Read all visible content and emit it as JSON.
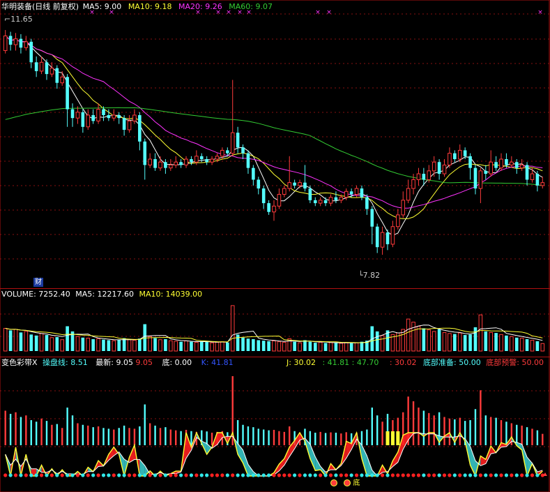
{
  "colors": {
    "bg": "#000000",
    "up": "#ff3b3b",
    "down": "#54ffff",
    "ma5": "#ffffff",
    "ma10": "#ffff33",
    "ma20": "#ff33ff",
    "ma60": "#33cc33",
    "grid": "#8a1010",
    "vol_ma5": "#ffffff",
    "vol_ma10": "#ffff33",
    "ribbon_up": "#ff2020",
    "ribbon_down": "#38c8c8",
    "dot_red": "#ff2020",
    "dot_cyan": "#30e8e8",
    "yellow": "#ffff33"
  },
  "main_header": {
    "name": "华明装备(日线 前复权)",
    "ma5_label": "MA5: 9.00",
    "ma10_label": "MA10: 9.18",
    "ma20_label": "MA20: 9.26",
    "ma60_label": "MA60: 9.07"
  },
  "annotations": {
    "high_label": "11.65",
    "low_label": "7.82",
    "cai_badge": "财",
    "di_label": "底",
    "cross_marker": "×"
  },
  "volume_header": {
    "title": "VOLUME: 7252.40",
    "ma5": "MA5: 12217.60",
    "ma10": "MA10: 14039.00"
  },
  "indicator_header": {
    "name": "变色彩带X",
    "caopan": "操盘线: 8.51",
    "zuixin": "最新: 9.05",
    "zuixin2": "9.05",
    "di": "底: 0.00",
    "k": "K: 41.81",
    "j": "J: 30.02",
    "v1": ": 41.81",
    "v2": ": 47.70",
    "v3": ": 30.02",
    "dibu_zhunbei": "底部准备: 50.00",
    "dibu_yujing": "底部预警: 50.00"
  },
  "chart_data": [
    {
      "type": "candlestick",
      "title": "华明装备(日线 前复权)",
      "ylim": [
        7.5,
        11.9
      ],
      "annotations": {
        "high": 11.65,
        "low": 7.82
      },
      "ma_latest": {
        "MA5": 9.0,
        "MA10": 9.18,
        "MA20": 9.26,
        "MA60": 9.07
      },
      "candles": [
        [
          11.3,
          11.55,
          11.65,
          11.25
        ],
        [
          11.55,
          11.4,
          11.62,
          11.3
        ],
        [
          11.4,
          11.5,
          11.6,
          11.3
        ],
        [
          11.5,
          11.35,
          11.58,
          11.25
        ],
        [
          11.35,
          11.45,
          11.55,
          11.3
        ],
        [
          11.45,
          11.1,
          11.5,
          11.0
        ],
        [
          11.1,
          10.95,
          11.2,
          10.85
        ],
        [
          10.95,
          11.1,
          11.2,
          10.9
        ],
        [
          11.1,
          10.9,
          11.15,
          10.8
        ],
        [
          10.9,
          11.0,
          11.1,
          10.85
        ],
        [
          11.0,
          10.75,
          11.05,
          10.65
        ],
        [
          10.75,
          10.85,
          10.95,
          10.7
        ],
        [
          10.85,
          10.3,
          10.9,
          10.0
        ],
        [
          10.3,
          10.15,
          10.4,
          10.0
        ],
        [
          10.15,
          10.25,
          10.35,
          10.05
        ],
        [
          10.25,
          10.0,
          10.3,
          9.9
        ],
        [
          10.0,
          10.2,
          10.3,
          9.95
        ],
        [
          10.2,
          10.1,
          10.3,
          10.05
        ],
        [
          10.1,
          10.3,
          10.4,
          10.05
        ],
        [
          10.3,
          10.2,
          10.35,
          10.1
        ],
        [
          10.2,
          10.15,
          10.3,
          10.1
        ],
        [
          10.15,
          10.2,
          10.3,
          10.1
        ],
        [
          10.2,
          10.15,
          10.25,
          10.05
        ],
        [
          10.15,
          9.95,
          10.2,
          9.85
        ],
        [
          9.95,
          10.1,
          10.2,
          9.9
        ],
        [
          10.1,
          10.2,
          10.3,
          10.05
        ],
        [
          10.2,
          9.75,
          10.25,
          9.6
        ],
        [
          9.75,
          9.35,
          9.8,
          9.1
        ],
        [
          9.35,
          9.45,
          9.55,
          9.3
        ],
        [
          9.45,
          9.3,
          9.55,
          9.25
        ],
        [
          9.3,
          9.4,
          9.5,
          9.25
        ],
        [
          9.4,
          9.3,
          9.45,
          9.2
        ],
        [
          9.3,
          9.35,
          9.45,
          9.25
        ],
        [
          9.35,
          9.4,
          9.5,
          9.3
        ],
        [
          9.4,
          9.35,
          9.45,
          9.3
        ],
        [
          9.35,
          9.45,
          9.5,
          9.3
        ],
        [
          9.45,
          9.4,
          9.5,
          9.35
        ],
        [
          9.4,
          9.5,
          9.6,
          9.35
        ],
        [
          9.5,
          9.45,
          9.55,
          9.4
        ],
        [
          9.45,
          9.4,
          9.5,
          9.35
        ],
        [
          9.4,
          9.45,
          9.5,
          9.35
        ],
        [
          9.45,
          9.5,
          9.55,
          9.4
        ],
        [
          9.5,
          9.6,
          9.65,
          9.45
        ],
        [
          9.6,
          9.55,
          9.65,
          9.5
        ],
        [
          9.55,
          9.9,
          10.8,
          9.5
        ],
        [
          9.9,
          9.65,
          10.0,
          9.55
        ],
        [
          9.65,
          9.55,
          9.7,
          9.45
        ],
        [
          9.55,
          9.3,
          9.6,
          9.2
        ],
        [
          9.3,
          9.1,
          9.35,
          9.0
        ],
        [
          9.1,
          8.95,
          9.15,
          8.85
        ],
        [
          8.95,
          8.7,
          9.0,
          8.6
        ],
        [
          8.7,
          8.55,
          8.75,
          8.5
        ],
        [
          8.55,
          8.65,
          8.75,
          8.4
        ],
        [
          8.65,
          8.85,
          8.95,
          8.6
        ],
        [
          8.85,
          8.95,
          9.0,
          8.8
        ],
        [
          8.95,
          9.05,
          9.5,
          8.9
        ],
        [
          9.05,
          9.0,
          9.1,
          8.95
        ],
        [
          9.0,
          9.05,
          9.1,
          8.95
        ],
        [
          9.05,
          8.95,
          9.35,
          8.9
        ],
        [
          8.95,
          8.75,
          9.0,
          8.7
        ],
        [
          8.75,
          8.7,
          8.8,
          8.65
        ],
        [
          8.7,
          8.75,
          8.8,
          8.65
        ],
        [
          8.75,
          8.7,
          8.8,
          8.65
        ],
        [
          8.7,
          8.8,
          8.85,
          8.65
        ],
        [
          8.8,
          8.75,
          8.9,
          8.7
        ],
        [
          8.75,
          8.8,
          8.85,
          8.7
        ],
        [
          8.8,
          8.9,
          8.95,
          8.75
        ],
        [
          8.9,
          8.85,
          8.95,
          8.8
        ],
        [
          8.85,
          8.95,
          9.0,
          8.8
        ],
        [
          8.95,
          8.8,
          9.0,
          8.75
        ],
        [
          8.8,
          8.6,
          8.85,
          8.5
        ],
        [
          8.6,
          8.3,
          8.65,
          8.0
        ],
        [
          8.3,
          7.95,
          8.35,
          7.85
        ],
        [
          7.95,
          8.2,
          8.3,
          7.82
        ],
        [
          8.2,
          8.0,
          8.25,
          7.9
        ],
        [
          8.0,
          8.3,
          8.4,
          7.95
        ],
        [
          8.3,
          8.5,
          8.6,
          8.25
        ],
        [
          8.5,
          8.75,
          8.9,
          8.45
        ],
        [
          8.75,
          8.95,
          9.1,
          8.7
        ],
        [
          8.95,
          9.1,
          9.2,
          8.85
        ],
        [
          9.1,
          9.2,
          9.3,
          9.0
        ],
        [
          9.2,
          9.1,
          9.3,
          9.0
        ],
        [
          9.1,
          9.25,
          9.35,
          9.05
        ],
        [
          9.25,
          9.4,
          9.5,
          9.15
        ],
        [
          9.4,
          9.2,
          9.45,
          9.1
        ],
        [
          9.2,
          9.35,
          9.45,
          9.15
        ],
        [
          9.35,
          9.55,
          9.65,
          9.3
        ],
        [
          9.55,
          9.45,
          9.6,
          9.4
        ],
        [
          9.45,
          9.6,
          9.7,
          9.4
        ],
        [
          9.6,
          9.5,
          9.65,
          9.45
        ],
        [
          9.5,
          9.3,
          9.55,
          9.1
        ],
        [
          9.3,
          8.95,
          9.35,
          8.85
        ],
        [
          8.95,
          9.25,
          9.3,
          8.7
        ],
        [
          9.25,
          9.2,
          9.35,
          9.1
        ],
        [
          9.2,
          9.4,
          9.6,
          9.15
        ],
        [
          9.4,
          9.3,
          9.5,
          9.25
        ],
        [
          9.3,
          9.45,
          9.55,
          9.25
        ],
        [
          9.45,
          9.35,
          9.55,
          9.3
        ],
        [
          9.35,
          9.4,
          9.5,
          9.3
        ],
        [
          9.4,
          9.3,
          9.45,
          9.2
        ],
        [
          9.3,
          9.35,
          9.45,
          9.25
        ],
        [
          9.35,
          9.1,
          9.4,
          9.0
        ],
        [
          9.1,
          9.2,
          9.3,
          9.05
        ],
        [
          9.2,
          9.0,
          9.25,
          8.9
        ],
        [
          9.0,
          9.05,
          9.15,
          8.95
        ]
      ]
    },
    {
      "type": "bar",
      "title": "VOLUME",
      "latest": 7252.4,
      "ma5": 12217.6,
      "ma10": 14039.0,
      "ylim": [
        0,
        48000
      ],
      "values": [
        22000,
        20000,
        21000,
        18000,
        19000,
        16000,
        15000,
        17000,
        15500,
        13000,
        13500,
        11000,
        24000,
        19000,
        14000,
        13000,
        12500,
        11500,
        12000,
        11000,
        10500,
        10000,
        11000,
        12500,
        11000,
        10500,
        12000,
        26000,
        14000,
        12500,
        11000,
        11500,
        10000,
        9500,
        9000,
        9800,
        9000,
        8500,
        9500,
        8800,
        8000,
        8500,
        9000,
        8300,
        44000,
        16000,
        13000,
        12000,
        11500,
        10500,
        10000,
        9500,
        9800,
        9000,
        8500,
        12000,
        9000,
        8000,
        10500,
        9000,
        8000,
        8500,
        7800,
        8200,
        8000,
        7500,
        8300,
        7600,
        8000,
        9000,
        10000,
        24000,
        19000,
        15000,
        20000,
        16000,
        17500,
        21000,
        31000,
        28000,
        24000,
        22000,
        20500,
        19000,
        21000,
        18000,
        17000,
        16500,
        17500,
        15500,
        16000,
        23000,
        35000,
        19000,
        18000,
        17500,
        16000,
        15000,
        14000,
        13000,
        12500,
        11500,
        10500,
        9500,
        7252.4
      ]
    },
    {
      "type": "line",
      "title": "变色彩带X",
      "latest": {
        "操盘线": 8.51,
        "最新": 9.05,
        "底": 0.0,
        "K": 41.81,
        "J": 30.02,
        "底部准备": 50.0,
        "底部预警": 50.0
      }
    }
  ]
}
